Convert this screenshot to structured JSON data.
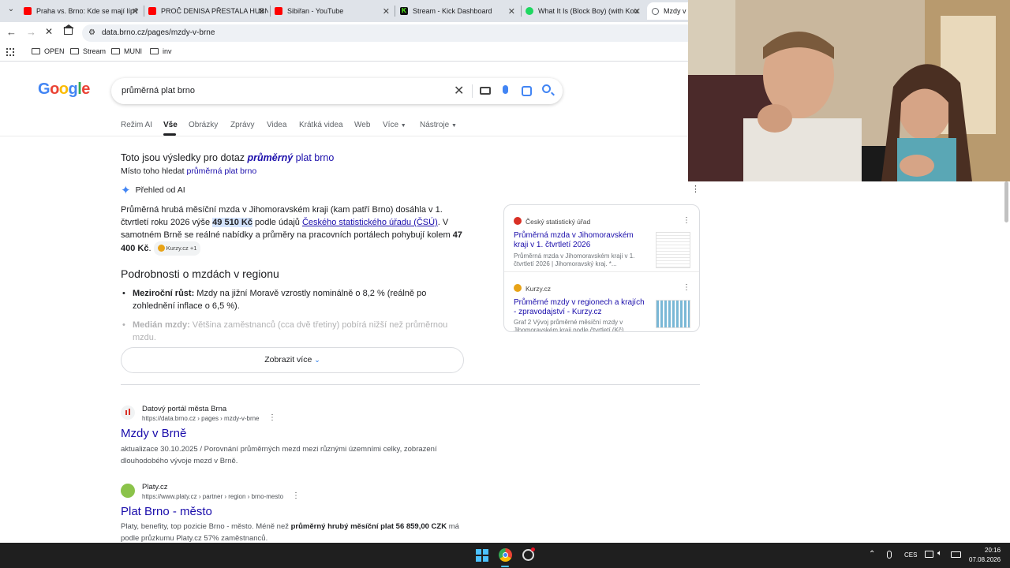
{
  "browser": {
    "tabs": [
      {
        "title": "Praha vs. Brno: Kde se mají líp?",
        "favicon": "youtube-icon",
        "color": "#ff0000"
      },
      {
        "title": "PROČ DENISA PŘESTALA HUBN",
        "favicon": "youtube-icon",
        "color": "#ff0000"
      },
      {
        "title": "Sibiřan - YouTube",
        "favicon": "youtube-icon",
        "color": "#ff0000"
      },
      {
        "title": "Stream - Kick Dashboard",
        "favicon": "kick-icon",
        "color": "#53fc18"
      },
      {
        "title": "What It Is (Block Boy) (with Kou",
        "favicon": "spotify-icon",
        "color": "#1ed760"
      },
      {
        "title": "Mzdy v B",
        "favicon": "page-icon",
        "color": "#5f6368"
      }
    ],
    "url": "data.brno.cz/pages/mzdy-v-brne",
    "bookmarks": [
      "OPEN",
      "Stream",
      "MUNI",
      "inv"
    ]
  },
  "google": {
    "logo": "Google",
    "query": "průměrná plat brno",
    "nav_tabs": [
      "Režim AI",
      "Vše",
      "Obrázky",
      "Zprávy",
      "Videa",
      "Krátká videa",
      "Web",
      "Více",
      "Nástroje"
    ],
    "correction": {
      "prefix": "Toto jsou výsledky pro dotaz",
      "corrected_bold": "průměrný",
      "corrected_rest": "plat brno",
      "instead_prefix": "Místo toho hledat",
      "instead_link": "průměrná plat brno"
    },
    "ai_overview": {
      "heading": "Přehled od AI",
      "p1_a": "Průměrná hrubá měsíční mzda v Jihomoravském kraji (kam patří Brno) dosáhla v 1. čtvrtletí roku 2026 výše",
      "p1_value": "49 510 Kč",
      "p1_b": "podle údajů",
      "p1_link": "Českého statistického úřadu (ČSÚ)",
      "p1_c": ". V samotném Brně se reálné nabídky a průměry na pracovních portálech pohybují kolem",
      "p1_value2": "47 400 Kč",
      "p1_end": ".",
      "source_chip": "Kurzy.cz +1",
      "subheading": "Podrobnosti o mzdách v regionu",
      "bullet1_bold": "Meziroční růst:",
      "bullet1_text": "Mzdy na jižní Moravě vzrostly nominálně o 8,2 % (reálně po zohlednění inflace o 6,5 %).",
      "bullet2_bold": "Medián mzdy:",
      "bullet2_text": "Většina zaměstnanců (cca dvě třetiny) pobírá nižší než průměrnou mzdu.",
      "show_more": "Zobrazit více"
    },
    "sources": [
      {
        "site": "Český statistický úřad",
        "title": "Průměrná mzda v Jihomoravském kraji v 1. čtvrtletí 2026",
        "snippet": "Průměrná mzda v Jihomoravském kraji v 1. čtvrtletí 2026 | Jihomoravský kraj. *...",
        "color": "#d93025"
      },
      {
        "site": "Kurzy.cz",
        "title": "Průměrné mzdy v regionech a krajích - zpravodajství - Kurzy.cz",
        "snippet": "Graf 2 Vývoj průměrné měsíční mzdy v Jihomoravském kraji podle čtvrtletí (Kč)",
        "color": "#e8a317"
      }
    ],
    "results": [
      {
        "site": "Datový portál města Brna",
        "url": "https://data.brno.cz › pages › mzdy-v-brne",
        "title": "Mzdy v Brně",
        "snippet": "aktualizace 30.10.2025 / Porovnání průměrných mezd mezi různými územními celky, zobrazení dlouhodobého vývoje mezd v Brně."
      },
      {
        "site": "Platy.cz",
        "url": "https://www.platy.cz › partner › region › brno-mesto",
        "title": "Plat Brno - město",
        "snippet_a": "Platy, benefity, top pozicie Brno - město. Méně než",
        "snippet_bold": "průměrný hrubý měsíční plat 56 859,00 CZK",
        "snippet_b": "má podle průzkumu Platy.cz 57% zaměstnanců."
      }
    ]
  },
  "taskbar": {
    "language": "CES",
    "time": "20:16",
    "date": "07.08.2026"
  }
}
